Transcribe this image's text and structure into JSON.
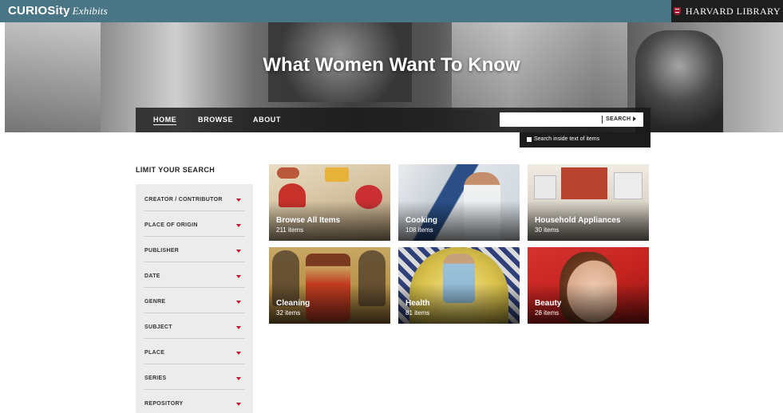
{
  "header": {
    "brand": "CURIOSity",
    "brand_sub": "Exhibits",
    "library": "HARVARD LIBRARY"
  },
  "hero": {
    "title": "What Women Want To Know"
  },
  "nav": {
    "items": [
      {
        "label": "HOME",
        "active": true
      },
      {
        "label": "BROWSE",
        "active": false
      },
      {
        "label": "ABOUT",
        "active": false
      }
    ]
  },
  "search": {
    "value": "",
    "button_label": "SEARCH",
    "inside_label": "Search inside text of items",
    "inside_checked": false
  },
  "sidebar": {
    "title": "LIMIT YOUR SEARCH",
    "facets": [
      "CREATOR / CONTRIBUTOR",
      "PLACE OF ORIGIN",
      "PUBLISHER",
      "DATE",
      "GENRE",
      "SUBJECT",
      "PLACE",
      "SERIES",
      "REPOSITORY"
    ]
  },
  "collections": [
    {
      "title": "Browse All Items",
      "count": "211 items"
    },
    {
      "title": "Cooking",
      "count": "108 items"
    },
    {
      "title": "Household Appliances",
      "count": "30 items"
    },
    {
      "title": "Cleaning",
      "count": "32 items"
    },
    {
      "title": "Health",
      "count": "81 items"
    },
    {
      "title": "Beauty",
      "count": "28 items"
    }
  ],
  "colors": {
    "topbar": "#4a7584",
    "harvard_crimson": "#a51c30",
    "facet_caret": "#c8102e"
  }
}
